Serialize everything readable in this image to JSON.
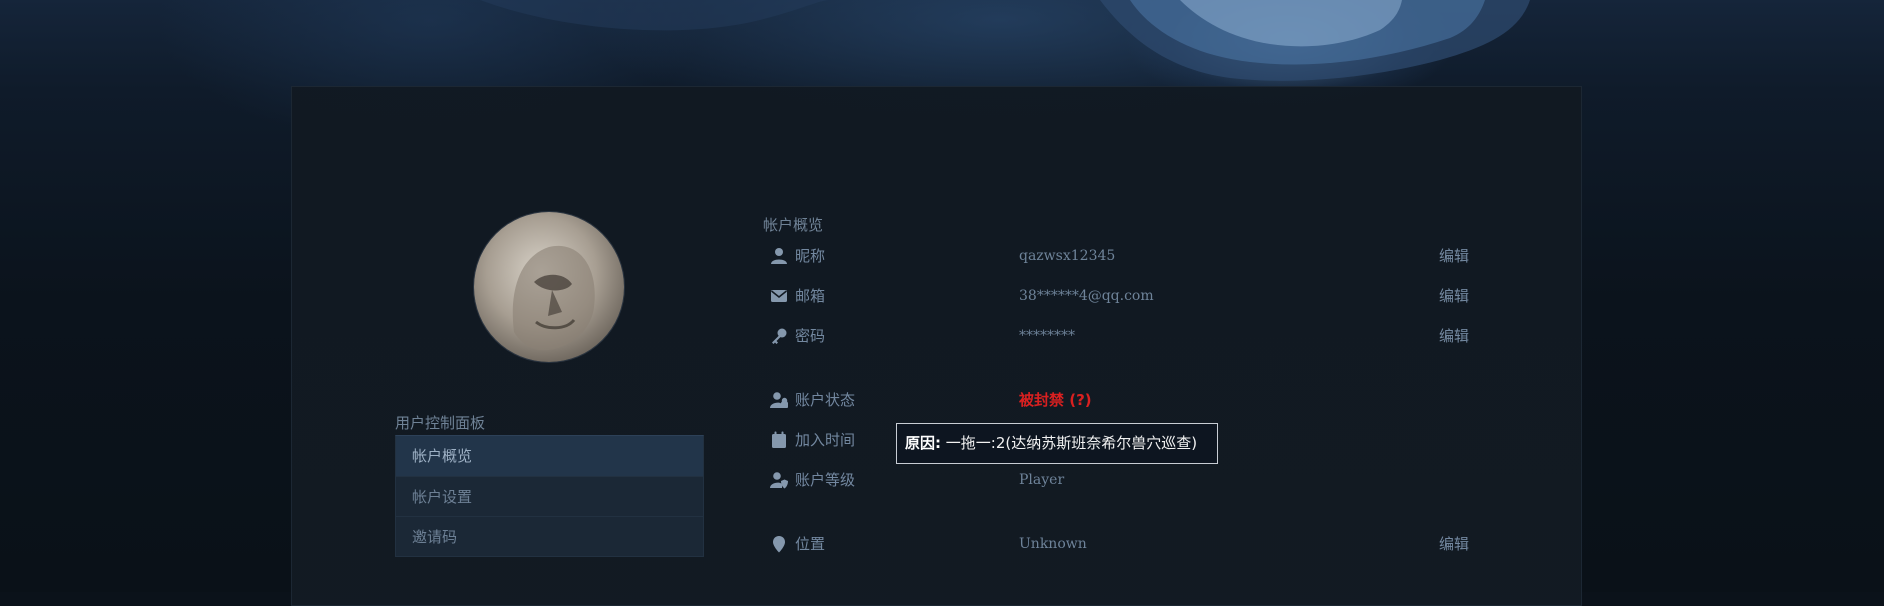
{
  "sidebar": {
    "title": "用户控制面板",
    "items": [
      {
        "label": "帐户概览",
        "active": true
      },
      {
        "label": "帐户设置",
        "active": false
      },
      {
        "label": "邀请码",
        "active": false
      }
    ]
  },
  "overview": {
    "title": "帐户概览",
    "rows": {
      "nickname": {
        "label": "昵称",
        "value": "qazwsx12345",
        "edit": "编辑",
        "icon": "user-icon"
      },
      "email": {
        "label": "邮箱",
        "value": "38******4@qq.com",
        "edit": "编辑",
        "icon": "envelope-icon"
      },
      "password": {
        "label": "密码",
        "value": "********",
        "edit": "编辑",
        "icon": "key-icon"
      },
      "status": {
        "label": "账户状态",
        "value": "被封禁 (?)",
        "icon": "user-lock-icon",
        "color": "#d92020"
      },
      "joined": {
        "label": "加入时间",
        "value": "",
        "icon": "calendar-icon"
      },
      "level": {
        "label": "账户等级",
        "value": "Player",
        "icon": "user-shield-icon"
      },
      "location": {
        "label": "位置",
        "value": "Unknown",
        "edit": "编辑",
        "icon": "map-pin-icon"
      }
    }
  },
  "tooltip": {
    "prefix": "原因:",
    "text": " 一拖一:2(达纳苏斯班奈希尔兽穴巡查)"
  }
}
